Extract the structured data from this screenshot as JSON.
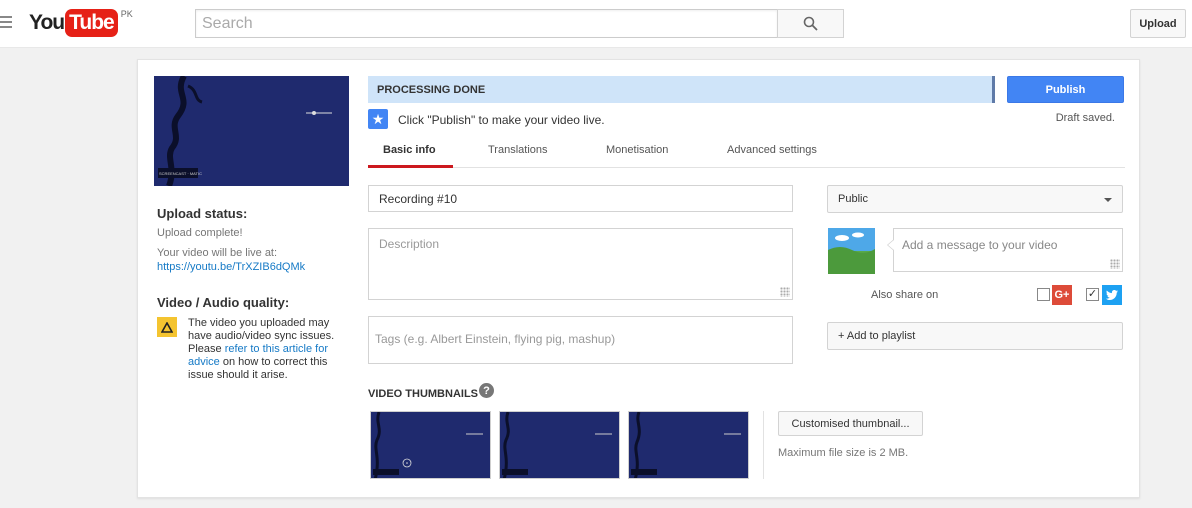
{
  "masthead": {
    "logo_you": "You",
    "logo_tube": "Tube",
    "country": "PK",
    "search_placeholder": "Search",
    "upload_label": "Upload"
  },
  "sidebar": {
    "upload_status_title": "Upload status:",
    "upload_status_text": "Upload complete!",
    "live_at_text": "Your video will be live at:",
    "video_url": "https://youtu.be/TrXZIB6dQMk",
    "quality_title": "Video / Audio quality:",
    "warning_pre": "The video you uploaded may have audio/video sync issues. Please ",
    "warning_link": "refer to this article for advice",
    "warning_post": " on how to correct this issue should it arise."
  },
  "status": {
    "processing_text": "PROCESSING DONE",
    "publish_label": "Publish",
    "draft_text": "Draft saved.",
    "click_message": "Click \"Publish\" to make your video live."
  },
  "tabs": [
    {
      "label": "Basic info",
      "active": true
    },
    {
      "label": "Translations",
      "active": false
    },
    {
      "label": "Monetisation",
      "active": false
    },
    {
      "label": "Advanced settings",
      "active": false
    }
  ],
  "form": {
    "title_value": "Recording #10",
    "description_placeholder": "Description",
    "tags_placeholder": "Tags (e.g. Albert Einstein, flying pig, mashup)",
    "privacy_value": "Public",
    "message_placeholder": "Add a message to your video",
    "share_label": "Also share on",
    "gplus_checked": false,
    "twitter_checked": true,
    "gplus_label": "G+",
    "add_to_playlist_label": "+ Add to playlist"
  },
  "thumbnails": {
    "title": "VIDEO THUMBNAILS",
    "custom_button_label": "Customised thumbnail...",
    "max_size_text": "Maximum file size is 2 MB.",
    "count": 3
  },
  "colors": {
    "publish_blue": "#4285f4",
    "status_bar": "#cfe4f9",
    "tab_underline": "#cc181e",
    "warning_yellow": "#f4c430",
    "link": "#167ac6"
  }
}
